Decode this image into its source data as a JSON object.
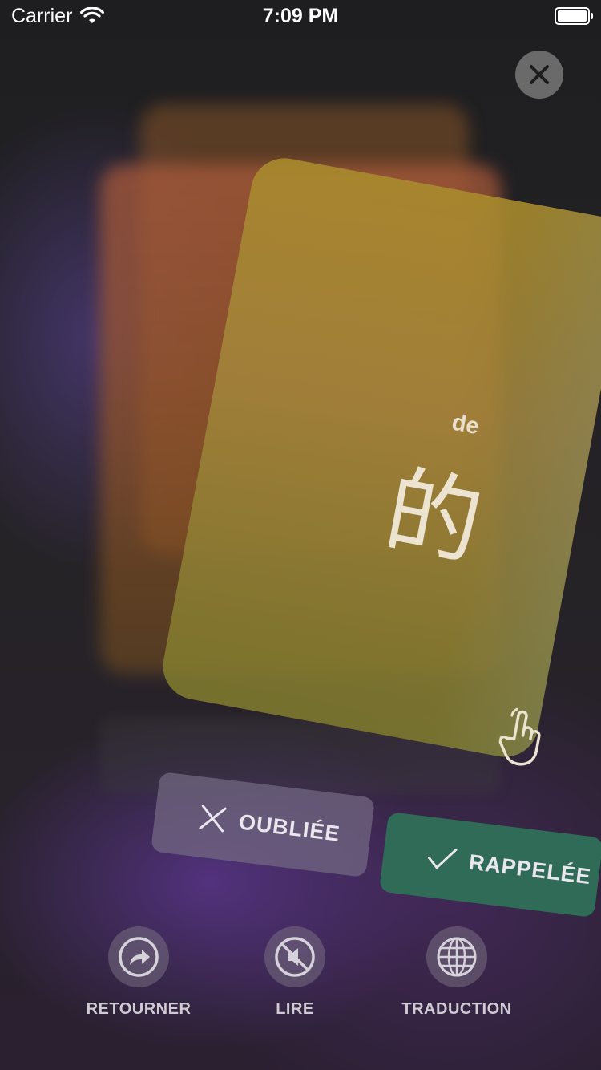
{
  "status_bar": {
    "carrier": "Carrier",
    "time": "7:09 PM"
  },
  "card": {
    "pinyin": "de",
    "hanzi": "的"
  },
  "actions": {
    "forgot": "OUBLIÉE",
    "recalled": "RAPPELÉE"
  },
  "toolbar": {
    "flip": "RETOURNER",
    "read": "LIRE",
    "translate": "TRADUCTION"
  },
  "colors": {
    "card": "#A88E3A",
    "recalled": "#2F6B57",
    "forgot": "#736982",
    "close": "#6A6A6A"
  },
  "icons": {
    "close": "close-icon",
    "hand": "tap-hand-icon",
    "forgot": "x-icon",
    "recalled": "check-icon",
    "flip": "share-arrow-icon",
    "read": "speaker-muted-icon",
    "translate": "globe-icon"
  }
}
